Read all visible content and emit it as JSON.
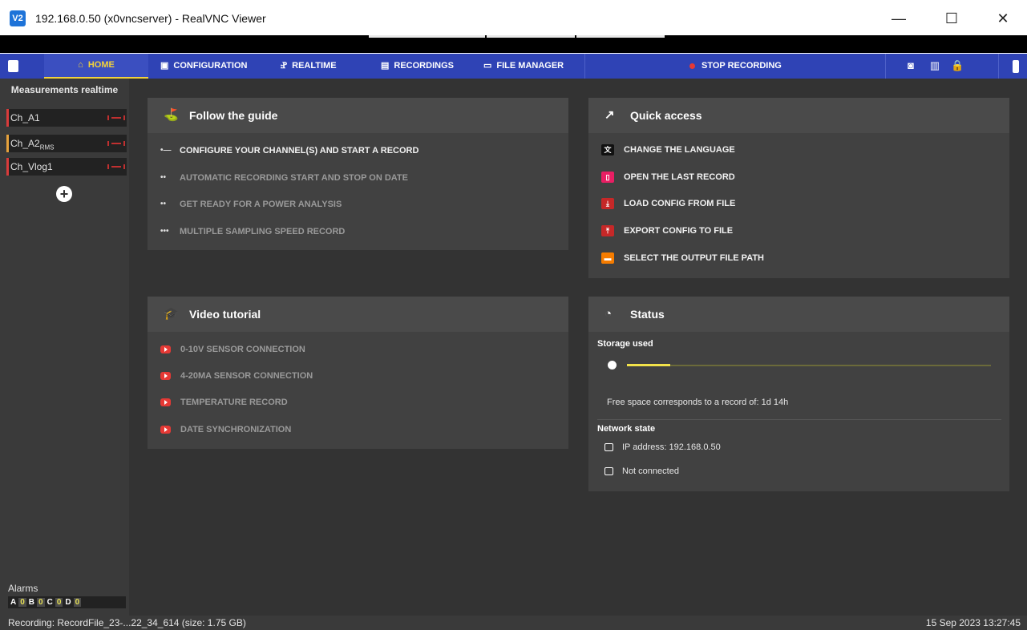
{
  "window": {
    "app_icon": "V2",
    "title": "192.168.0.50 (x0vncserver) - RealVNC Viewer",
    "min_glyph": "—",
    "max_glyph": "☐",
    "close_glyph": "✕"
  },
  "nav": {
    "items": [
      {
        "label": "HOME",
        "icon": "home-icon",
        "glyph": "⌂"
      },
      {
        "label": "CONFIGURATION",
        "icon": "config-icon",
        "glyph": "▣"
      },
      {
        "label": "REALTIME",
        "icon": "realtime-icon",
        "glyph": "Ⱀ"
      },
      {
        "label": "RECORDINGS",
        "icon": "recordings-icon",
        "glyph": "▤"
      },
      {
        "label": "FILE MANAGER",
        "icon": "folder-icon",
        "glyph": "▭"
      }
    ],
    "stop_recording": "STOP RECORDING",
    "right_icons": [
      "camera-icon",
      "book-icon",
      "lock-icon",
      "battery-icon"
    ],
    "camera_glyph": "◙",
    "book_glyph": "▥",
    "lock_glyph": "🔒"
  },
  "sidebar": {
    "title": "Measurements realtime",
    "channels": [
      {
        "name": "Ch_A1",
        "sub": ""
      },
      {
        "name": "Ch_A2",
        "sub": "RMS"
      },
      {
        "name": "Ch_Vlog1",
        "sub": ""
      }
    ],
    "add_glyph": "+",
    "alarms_label": "Alarms",
    "alarms": [
      {
        "letter": "A",
        "count": "0"
      },
      {
        "letter": "B",
        "count": "0"
      },
      {
        "letter": "C",
        "count": "0"
      },
      {
        "letter": "D",
        "count": "0"
      }
    ]
  },
  "guide": {
    "title": "Follow the guide",
    "icon_glyph": "⛳",
    "steps": [
      {
        "bullet": "•—",
        "label": "CONFIGURE YOUR CHANNEL(S) AND START A RECORD"
      },
      {
        "bullet": "••",
        "label": "AUTOMATIC RECORDING START AND STOP ON DATE"
      },
      {
        "bullet": "••",
        "label": "GET READY FOR A POWER ANALYSIS"
      },
      {
        "bullet": "•••",
        "label": "MULTIPLE SAMPLING SPEED RECORD"
      }
    ]
  },
  "quick": {
    "title": "Quick access",
    "icon_glyph": "↗",
    "items": [
      {
        "label": "CHANGE THE LANGUAGE",
        "icon": "translate-icon",
        "glyph": "文",
        "color": "#111111"
      },
      {
        "label": "OPEN THE LAST RECORD",
        "icon": "file-open-icon",
        "glyph": "▯",
        "color": "#e91e63"
      },
      {
        "label": "LOAD CONFIG FROM FILE",
        "icon": "download-icon",
        "glyph": "⤓",
        "color": "#c62828"
      },
      {
        "label": "EXPORT CONFIG TO FILE",
        "icon": "upload-icon",
        "glyph": "⤒",
        "color": "#c62828"
      },
      {
        "label": "SELECT THE OUTPUT FILE PATH",
        "icon": "folder-icon",
        "glyph": "▬",
        "color": "#f57c00"
      }
    ]
  },
  "video": {
    "title": "Video tutorial",
    "icon_glyph": "🎓",
    "items": [
      {
        "label": "0-10V SENSOR CONNECTION"
      },
      {
        "label": "4-20MA SENSOR CONNECTION"
      },
      {
        "label": "TEMPERATURE RECORD"
      },
      {
        "label": "DATE SYNCHRONIZATION"
      }
    ]
  },
  "status": {
    "title": "Status",
    "icon_glyph": "◔",
    "storage_label": "Storage used",
    "storage_fraction": 0.12,
    "free_space": "Free space corresponds to a record of: 1d 14h",
    "network_label": "Network state",
    "ip": "IP address: 192.168.0.50",
    "connection": "Not connected"
  },
  "statusbar": {
    "recording": "Recording: RecordFile_23-...22_34_614 (size: 1.75 GB)",
    "datetime": "15 Sep 2023 13:27:45"
  },
  "colors": {
    "nav_bg": "#2f43b5",
    "accent_yellow": "#f2d23c",
    "card_bg": "#414141",
    "main_bg": "#333333"
  }
}
